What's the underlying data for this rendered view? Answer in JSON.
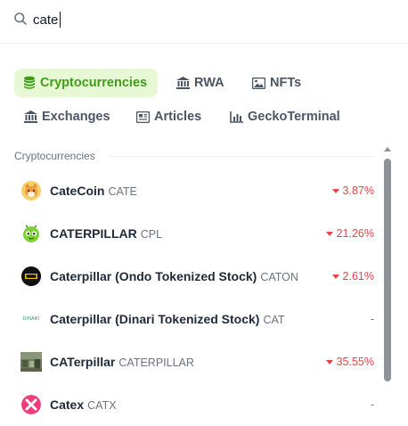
{
  "search": {
    "value": "cate"
  },
  "tabs": [
    {
      "label": "Cryptocurrencies",
      "icon": "coins-icon",
      "active": true
    },
    {
      "label": "RWA",
      "icon": "bank-icon"
    },
    {
      "label": "NFTs",
      "icon": "image-icon"
    },
    {
      "label": "Exchanges",
      "icon": "bank-icon"
    },
    {
      "label": "Articles",
      "icon": "newspaper-icon"
    },
    {
      "label": "GeckoTerminal",
      "icon": "chart-bar-icon"
    }
  ],
  "section": {
    "title": "Cryptocurrencies"
  },
  "results": [
    {
      "name": "CateCoin",
      "symbol": "CATE",
      "change": "3.87%",
      "direction": "down"
    },
    {
      "name": "CATERPILLAR",
      "symbol": "CPL",
      "change": "21.26%",
      "direction": "down"
    },
    {
      "name": "Caterpillar (Ondo Tokenized Stock)",
      "symbol": "CATON",
      "change": "2.61%",
      "direction": "down"
    },
    {
      "name": "Caterpillar (Dinari Tokenized Stock)",
      "symbol": "CAT",
      "change": "-",
      "direction": "none",
      "logo_text": "DINARI"
    },
    {
      "name": "CATerpillar",
      "symbol": "CATERPILLAR",
      "change": "35.55%",
      "direction": "down"
    },
    {
      "name": "Catex",
      "symbol": "CATX",
      "change": "-",
      "direction": "none"
    }
  ],
  "colors": {
    "accent": "#3e9d17",
    "accent_bg": "#e6f9d4",
    "negative": "#e54545",
    "muted": "#6b7280"
  }
}
